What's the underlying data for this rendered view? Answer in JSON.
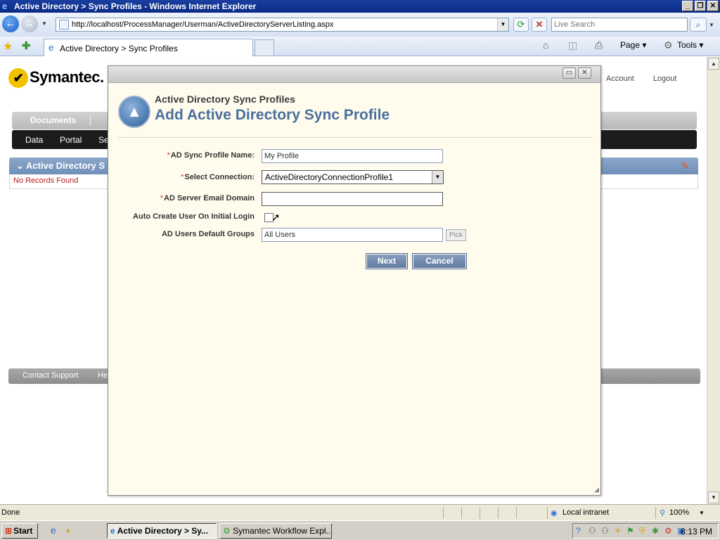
{
  "browser": {
    "window_title": "Active Directory > Sync Profiles - Windows Internet Explorer",
    "url": "http://localhost/ProcessManager/Userman/ActiveDirectoryServerListing.aspx",
    "search_placeholder": "Live Search",
    "tab_label": "Active Directory > Sync Profiles",
    "commands": {
      "page": "Page",
      "tools": "Tools"
    }
  },
  "app": {
    "logo_text": "Symantec.",
    "top_links": [
      "Account",
      "Logout"
    ],
    "menu_primary": [
      "Documents"
    ],
    "menu_secondary": [
      "Data",
      "Portal",
      "Se"
    ],
    "section_title": "Active Directory S",
    "no_records": "No Records Found",
    "footer_links": [
      "Contact Support",
      "He"
    ]
  },
  "dialog": {
    "subtitle": "Active Directory Sync Profiles",
    "title": "Add Active Directory Sync Profile",
    "fields": {
      "profile_name": {
        "label": "AD Sync Profile Name:",
        "value": "My Profile"
      },
      "connection": {
        "label": "Select Connection:",
        "value": "ActiveDirectoryConnectionProfile1"
      },
      "email_domain": {
        "label": "AD Server Email Domain",
        "value": ""
      },
      "auto_create": {
        "label": "Auto Create User On Initial Login",
        "checked": false
      },
      "default_groups": {
        "label": "AD Users Default Groups",
        "value": "All Users"
      }
    },
    "pick_label": "Pick",
    "next_label": "Next",
    "cancel_label": "Cancel"
  },
  "status": {
    "text": "Done",
    "zone": "Local intranet",
    "zoom": "100%"
  },
  "taskbar": {
    "start_label": "Start",
    "items": [
      "Active Directory > Sy...",
      "Symantec Workflow Expl..."
    ],
    "clock": "8:13 PM"
  }
}
